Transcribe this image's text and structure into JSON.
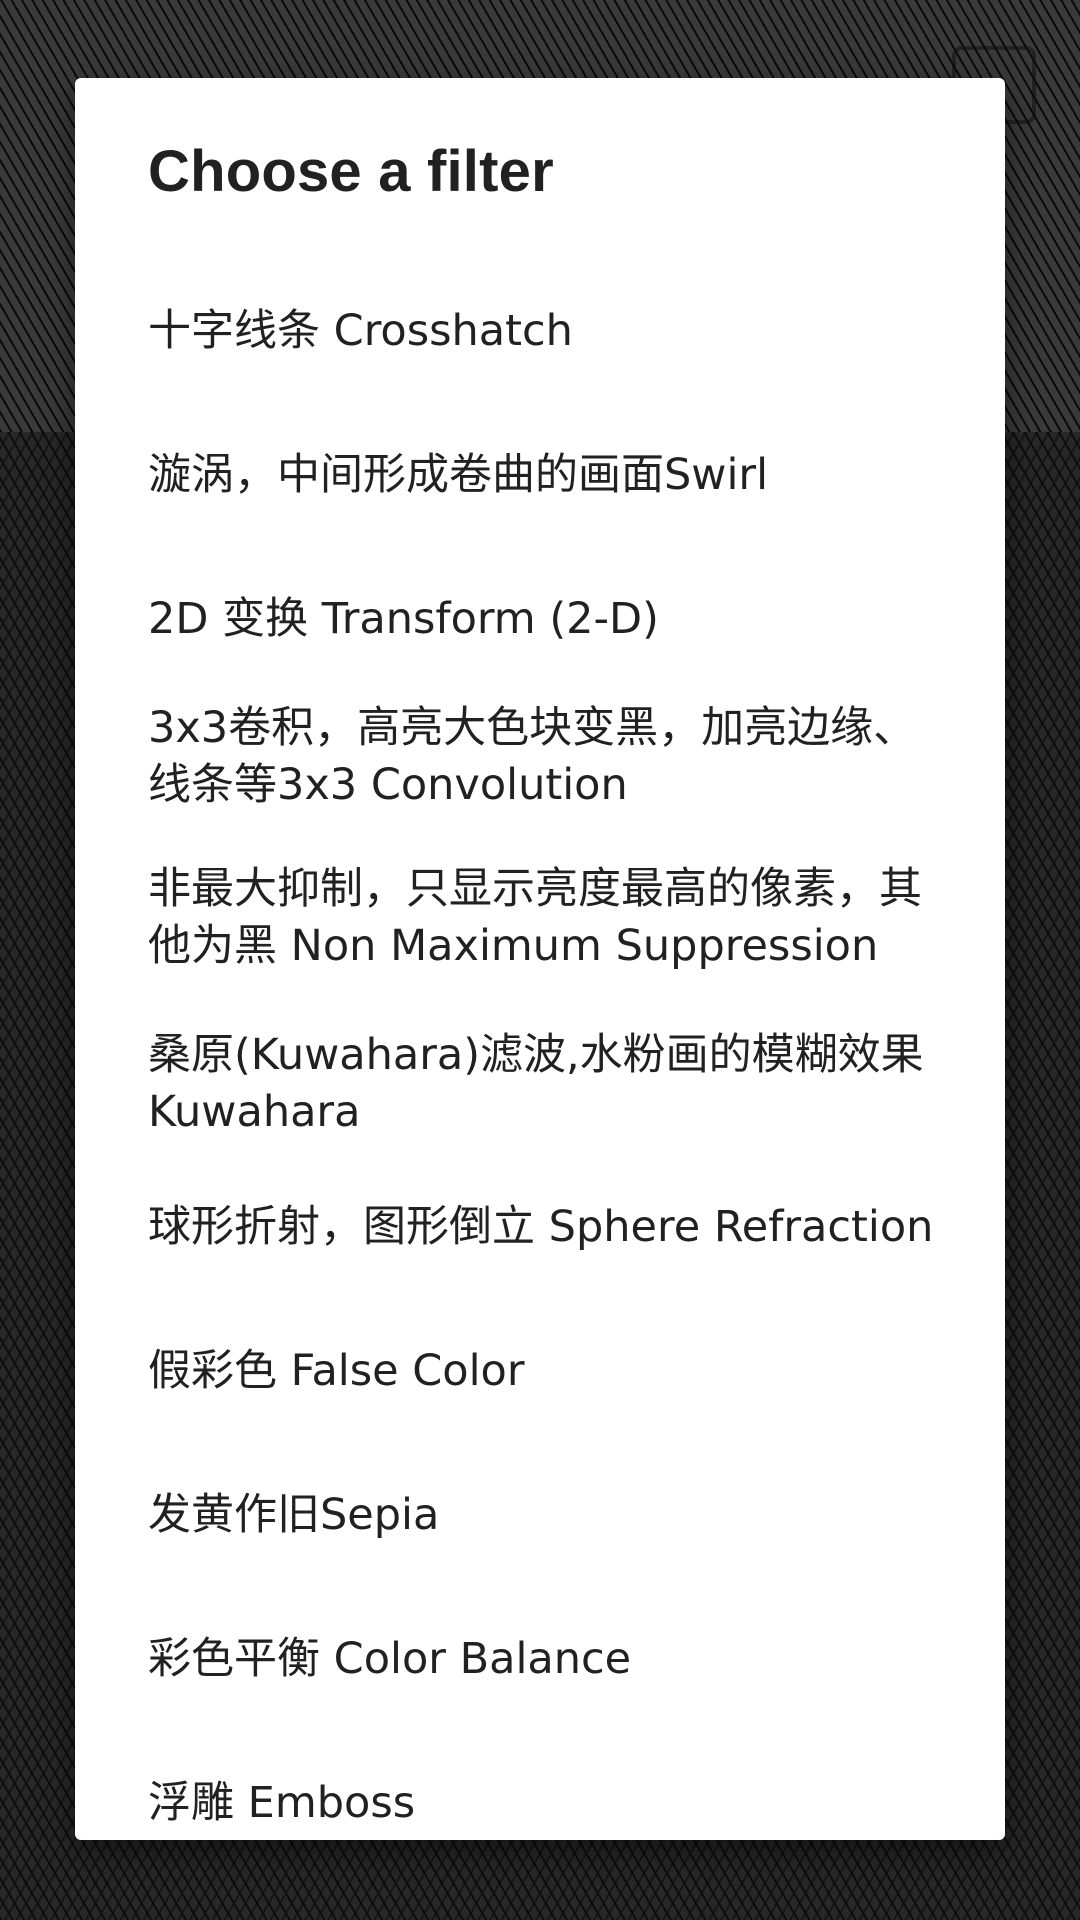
{
  "dialog": {
    "title": "Choose a filter",
    "items": [
      {
        "label": "十字线条 Crosshatch"
      },
      {
        "label": "漩涡，中间形成卷曲的画面Swirl"
      },
      {
        "label": "2D 变换 Transform (2-D)"
      },
      {
        "label": "3x3卷积，高亮大色块变黑，加亮边缘、线条等3x3 Convolution"
      },
      {
        "label": "非最大抑制，只显示亮度最高的像素，其他为黑  Non Maximum Suppression"
      },
      {
        "label": "桑原(Kuwahara)滤波,水粉画的模糊效果 Kuwahara"
      },
      {
        "label": "球形折射，图形倒立 Sphere Refraction"
      },
      {
        "label": "假彩色 False Color"
      },
      {
        "label": "发黄作旧Sepia"
      },
      {
        "label": "彩色平衡 Color Balance"
      },
      {
        "label": "浮雕 Emboss"
      }
    ]
  },
  "colors": {
    "dialog_bg": "#ffffff",
    "text": "#212121",
    "scrim": "rgba(0,0,0,0.35)"
  },
  "icons": {
    "background_camera": "camera-switch-icon"
  }
}
